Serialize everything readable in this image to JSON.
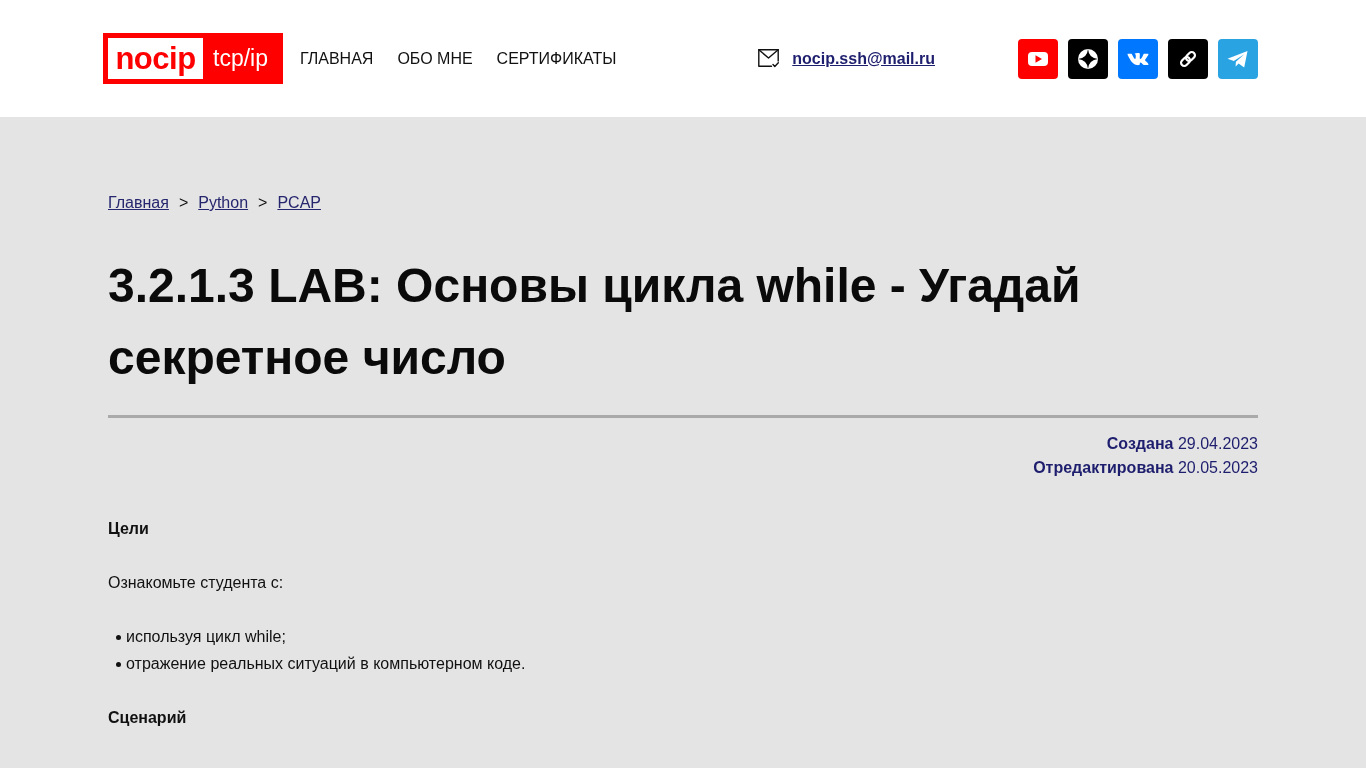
{
  "header": {
    "logo": {
      "name": "nocip",
      "tag": "tcp/ip"
    },
    "nav": [
      {
        "label": "ГЛАВНАЯ"
      },
      {
        "label": "ОБО МНЕ"
      },
      {
        "label": "СЕРТИФИКАТЫ"
      }
    ],
    "email": "nocip.ssh@mail.ru",
    "social": [
      {
        "kind": "youtube",
        "color": "#ff0000"
      },
      {
        "kind": "dzen",
        "color": "#000000"
      },
      {
        "kind": "vk",
        "color": "#0077ff"
      },
      {
        "kind": "link",
        "color": "#000000"
      },
      {
        "kind": "telegram",
        "color": "#2aa3e3"
      }
    ]
  },
  "breadcrumbs": [
    {
      "label": "Главная",
      "separator": ">"
    },
    {
      "label": "Python",
      "separator": ">"
    },
    {
      "label": "PCAP"
    }
  ],
  "title": "3.2.1.3 LAB: Основы цикла while - Угадай секретное число",
  "dates": [
    "**Создана** 29.04.2023",
    "**Отредактирована** 20.05.2023"
  ],
  "article": [
    {
      "kind": "heading",
      "text": "Цели"
    },
    {
      "kind": "paragraph",
      "text": "Ознакомьте студента с:"
    },
    {
      "kind": "list",
      "items": [
        "используя цикл while;",
        "отражение реальных ситуаций в компьютерном коде."
      ]
    },
    {
      "kind": "heading",
      "text": "Сценарий"
    }
  ]
}
